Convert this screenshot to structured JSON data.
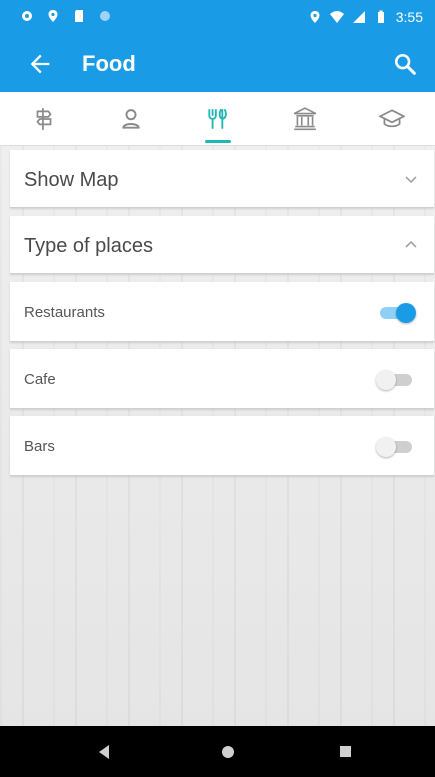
{
  "status_bar": {
    "time": "3:55",
    "left_icons": [
      "settings-icon",
      "location-icon",
      "sd-card-icon",
      "circle-icon"
    ],
    "right_icons": [
      "location-icon",
      "wifi-icon",
      "signal-icon",
      "battery-icon"
    ]
  },
  "app_bar": {
    "title": "Food",
    "back_icon": "arrow-left-icon",
    "search_icon": "search-icon"
  },
  "tabs": [
    {
      "icon": "sign-icon",
      "active": false
    },
    {
      "icon": "person-pin-icon",
      "active": false
    },
    {
      "icon": "restaurant-icon",
      "active": true
    },
    {
      "icon": "museum-icon",
      "active": false
    },
    {
      "icon": "graduation-cap-icon",
      "active": false
    }
  ],
  "sections": {
    "show_map": {
      "label": "Show Map",
      "expanded": false
    },
    "type_of_places": {
      "label": "Type of places",
      "expanded": true
    }
  },
  "places": [
    {
      "label": "Restaurants",
      "enabled": true
    },
    {
      "label": "Cafe",
      "enabled": false
    },
    {
      "label": "Bars",
      "enabled": false
    }
  ],
  "colors": {
    "primary": "#1a9be6",
    "tab_indicator": "#1eb7b2",
    "active_tab_icon": "#1eb7b2"
  },
  "nav_bar": {
    "buttons": [
      "back-triangle-icon",
      "home-circle-icon",
      "recents-square-icon"
    ]
  }
}
